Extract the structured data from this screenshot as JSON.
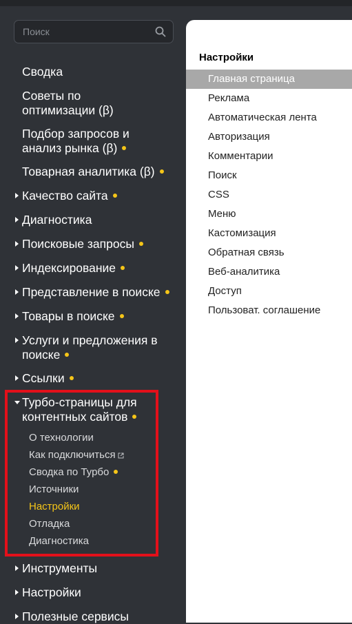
{
  "search": {
    "placeholder": "Поиск"
  },
  "sidebar": {
    "items": [
      {
        "label": "Сводка"
      },
      {
        "label": "Советы по оптимизации (β)"
      },
      {
        "label": "Подбор запросов и анализ рынка (β)"
      },
      {
        "label": "Товарная аналитика (β)"
      },
      {
        "label": "Качество сайта"
      },
      {
        "label": "Диагностика"
      },
      {
        "label": "Поисковые запросы"
      },
      {
        "label": "Индексирование"
      },
      {
        "label": "Представление в поиске"
      },
      {
        "label": "Товары в поиске"
      },
      {
        "label": "Услуги и предложения в поиске"
      },
      {
        "label": "Ссылки"
      },
      {
        "label": "Турбо-страницы для контентных сайтов"
      },
      {
        "label": "Инструменты"
      },
      {
        "label": "Настройки"
      },
      {
        "label": "Полезные сервисы"
      }
    ],
    "turbo_sub": [
      {
        "label": "О технологии"
      },
      {
        "label": "Как подключиться"
      },
      {
        "label": "Сводка по Турбо"
      },
      {
        "label": "Источники"
      },
      {
        "label": "Настройки"
      },
      {
        "label": "Отладка"
      },
      {
        "label": "Диагностика"
      }
    ]
  },
  "settings_panel": {
    "title": "Настройки",
    "selected": "Главная страница",
    "items": [
      {
        "label": "Главная страница"
      },
      {
        "label": "Реклама"
      },
      {
        "label": "Автоматическая лента"
      },
      {
        "label": "Авторизация"
      },
      {
        "label": "Комментарии"
      },
      {
        "label": "Поиск"
      },
      {
        "label": "CSS"
      },
      {
        "label": "Меню"
      },
      {
        "label": "Кастомизация"
      },
      {
        "label": "Обратная связь"
      },
      {
        "label": "Веб-аналитика"
      },
      {
        "label": "Доступ"
      },
      {
        "label": "Пользоват. соглашение"
      }
    ]
  },
  "colors": {
    "background": "#2f3237",
    "accent": "#f5c518",
    "highlight_frame": "#e3101a",
    "selected_row": "#a8a8a8"
  }
}
